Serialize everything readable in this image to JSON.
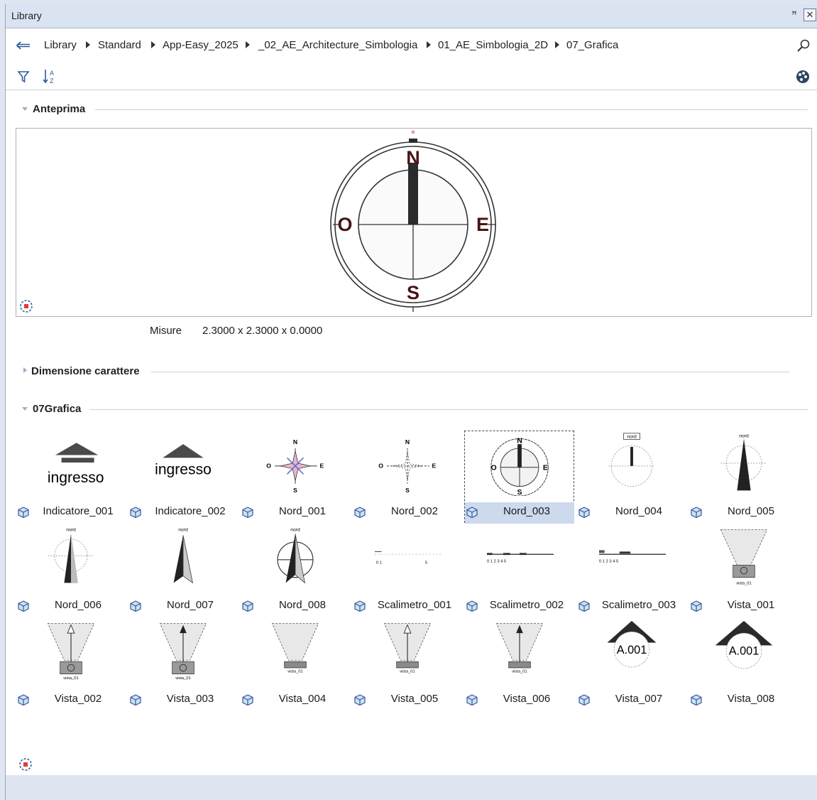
{
  "window": {
    "title": "Library",
    "pin": "ꟸ",
    "close": "✕"
  },
  "breadcrumb": [
    "Library",
    "Standard",
    "App-Easy_2025",
    "_02_AE_Architecture_Simbologia",
    "01_AE_Simbologia_2D",
    "07_Grafica"
  ],
  "sections": {
    "preview": "Anteprima",
    "char": "Dimensione carattere",
    "grafica": "07Grafica"
  },
  "preview": {
    "measure_label": "Misure",
    "measure_value": "2.3000 x 2.3000 x 0.0000"
  },
  "items": [
    {
      "label": "Indicatore_001",
      "kind": "ingresso1"
    },
    {
      "label": "Indicatore_002",
      "kind": "ingresso2"
    },
    {
      "label": "Nord_001",
      "kind": "rose1"
    },
    {
      "label": "Nord_002",
      "kind": "rose2"
    },
    {
      "label": "Nord_003",
      "kind": "compass",
      "selected": true
    },
    {
      "label": "Nord_004",
      "kind": "nord4"
    },
    {
      "label": "Nord_005",
      "kind": "nord5"
    },
    {
      "label": "Nord_006",
      "kind": "nord6"
    },
    {
      "label": "Nord_007",
      "kind": "nord7"
    },
    {
      "label": "Nord_008",
      "kind": "nord8"
    },
    {
      "label": "Scalimetro_001",
      "kind": "scale1"
    },
    {
      "label": "Scalimetro_002",
      "kind": "scale2"
    },
    {
      "label": "Scalimetro_003",
      "kind": "scale3"
    },
    {
      "label": "Vista_001",
      "kind": "vista1"
    },
    {
      "label": "Vista_002",
      "kind": "vista2"
    },
    {
      "label": "Vista_003",
      "kind": "vista3"
    },
    {
      "label": "Vista_004",
      "kind": "vista4"
    },
    {
      "label": "Vista_005",
      "kind": "vista5"
    },
    {
      "label": "Vista_006",
      "kind": "vista6"
    },
    {
      "label": "Vista_007",
      "kind": "vista7"
    },
    {
      "label": "Vista_008",
      "kind": "vista8"
    }
  ],
  "thumb_text": {
    "ingresso": "ingresso",
    "nord": "nord",
    "N": "N",
    "S": "S",
    "E": "E",
    "O": "O",
    "vista": "vista_01",
    "a001": "A.001"
  },
  "icons": {
    "back": "back-arrow-icon",
    "search": "search-icon",
    "filter": "filter-icon",
    "sort": "sort-az-icon",
    "palette": "palette-icon",
    "anchor": "anchor-point-icon",
    "cube": "cube-icon"
  }
}
